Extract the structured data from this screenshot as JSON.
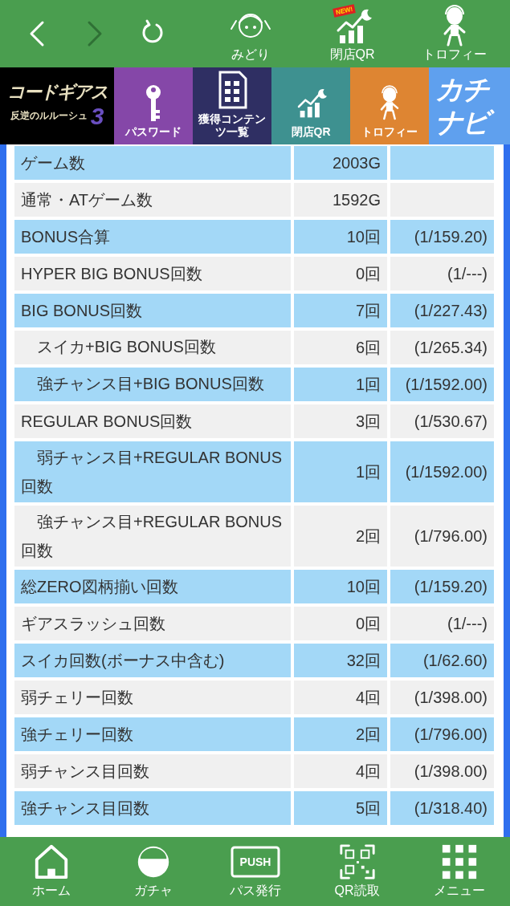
{
  "top_bar": {
    "nav": [
      {
        "kind": "back",
        "disabled": false
      },
      {
        "kind": "forward",
        "disabled": true
      },
      {
        "kind": "reload",
        "disabled": false
      }
    ],
    "items": [
      {
        "kind": "character",
        "label": "みどり"
      },
      {
        "kind": "chart",
        "label": "閉店QR",
        "badge": "NEW!"
      },
      {
        "kind": "alien",
        "label": "トロフィー"
      }
    ]
  },
  "tiles": [
    {
      "kind": "logo",
      "title": "コードギアス",
      "subtitle": "反逆のルルーシュ",
      "number": "3",
      "color": "#000000"
    },
    {
      "kind": "key",
      "label": "パスワード",
      "color": "#8547a8"
    },
    {
      "kind": "list",
      "label": "獲得コンテンツ一覧",
      "color": "#2f2f63"
    },
    {
      "kind": "chart",
      "label": "閉店QR",
      "color": "#3e9190"
    },
    {
      "kind": "alien",
      "label": "トロフィー",
      "color": "#de8532"
    },
    {
      "kind": "navi",
      "title": "カチ",
      "subtitle": "ナビ",
      "color": "#5fa0ee"
    }
  ],
  "table": {
    "rows": [
      {
        "label": "ゲーム数",
        "value": "2003G"
      },
      {
        "label": "通常・ATゲーム数",
        "value": "1592G"
      },
      {
        "label": "BONUS合算",
        "value": "10回",
        "ratio": "(1/159.20)"
      },
      {
        "label": "HYPER BIG BONUS回数",
        "value": "0回",
        "ratio": "(1/---)"
      },
      {
        "label": "BIG BONUS回数",
        "value": "7回",
        "ratio": "(1/227.43)",
        "children": [
          {
            "label": "スイカ+BIG BONUS回数",
            "value": "6回",
            "ratio": "(1/265.34)"
          },
          {
            "label": "強チャンス目+BIG BONUS回数",
            "value": "1回",
            "ratio": "(1/1592.00)"
          }
        ]
      },
      {
        "label": "REGULAR BONUS回数",
        "value": "3回",
        "ratio": "(1/530.67)",
        "children": [
          {
            "label": "弱チャンス目+REGULAR BONUS回数",
            "value": "1回",
            "ratio": "(1/1592.00)"
          },
          {
            "label": "強チャンス目+REGULAR BONUS回数",
            "value": "2回",
            "ratio": "(1/796.00)"
          }
        ]
      },
      {
        "label": "総ZERO図柄揃い回数",
        "value": "10回",
        "ratio": "(1/159.20)"
      },
      {
        "label": "ギアスラッシュ回数",
        "value": "0回",
        "ratio": "(1/---)"
      },
      {
        "label": "スイカ回数(ボーナス中含む)",
        "value": "32回",
        "ratio": "(1/62.60)"
      },
      {
        "label": "弱チェリー回数",
        "value": "4回",
        "ratio": "(1/398.00)"
      },
      {
        "label": "強チェリー回数",
        "value": "2回",
        "ratio": "(1/796.00)"
      },
      {
        "label": "弱チャンス目回数",
        "value": "4回",
        "ratio": "(1/398.00)"
      },
      {
        "label": "強チャンス目回数",
        "value": "5回",
        "ratio": "(1/318.40)"
      }
    ]
  },
  "bottom_nav": [
    {
      "kind": "home",
      "label": "ホーム"
    },
    {
      "kind": "gacha",
      "label": "ガチャ"
    },
    {
      "kind": "push",
      "label": "パス発行",
      "icon_text": "PUSH"
    },
    {
      "kind": "qr",
      "label": "QR読取"
    },
    {
      "kind": "grid",
      "label": "メニュー"
    }
  ]
}
